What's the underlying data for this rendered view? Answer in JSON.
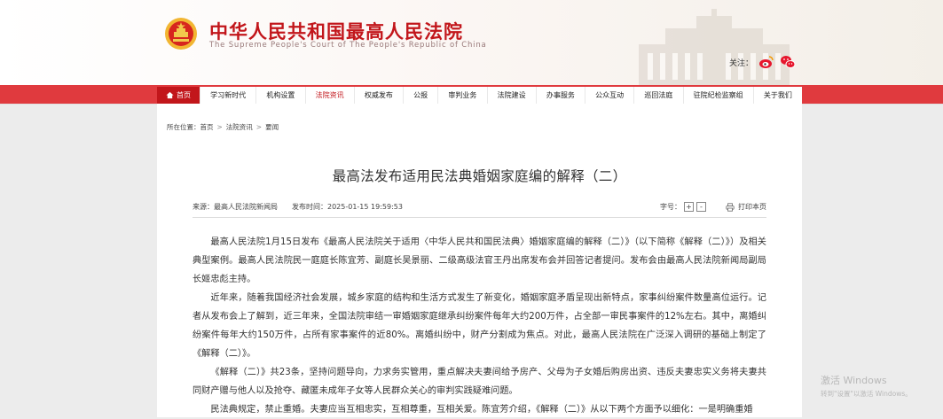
{
  "header": {
    "title": "中华人民共和国最高人民法院",
    "subtitle": "The Supreme People's Court of The People's Republic of China",
    "follow_label": "关注：",
    "social": [
      {
        "name": "weibo-icon",
        "color": "#e6162d"
      },
      {
        "name": "wechat-icon",
        "color": "#e6162d"
      }
    ]
  },
  "nav": {
    "items": [
      {
        "label": "首页",
        "icon": "home-icon",
        "state": "home"
      },
      {
        "label": "学习新时代"
      },
      {
        "label": "机构设置"
      },
      {
        "label": "法院资讯",
        "state": "active"
      },
      {
        "label": "权威发布"
      },
      {
        "label": "公报"
      },
      {
        "label": "审判业务"
      },
      {
        "label": "法院建设"
      },
      {
        "label": "办事服务"
      },
      {
        "label": "公众互动"
      },
      {
        "label": "巡回法庭"
      },
      {
        "label": "驻院纪检监察组"
      },
      {
        "label": "关于我们"
      }
    ]
  },
  "breadcrumb": {
    "prefix": "所在位置：",
    "items": [
      "首页",
      "法院资讯",
      "要闻"
    ],
    "separator": ">"
  },
  "article": {
    "title": "最高法发布适用民法典婚姻家庭编的解释（二）",
    "source": "来源：最高人民法院新闻局",
    "publish_time": "发布时间：2025-01-15 19:59:53",
    "font_size_label": "字号：",
    "font_increase": "+",
    "font_decrease": "-",
    "print_label": "打印本页",
    "paragraphs": [
      "最高人民法院1月15日发布《最高人民法院关于适用〈中华人民共和国民法典〉婚姻家庭编的解释（二）》（以下简称《解释（二）》）及相关典型案例。最高人民法院民一庭庭长陈宜芳、副庭长吴景丽、二级高级法官王丹出席发布会并回答记者提问。发布会由最高人民法院新闻局副局长姬忠彪主持。",
      "近年来，随着我国经济社会发展，城乡家庭的结构和生活方式发生了新变化，婚姻家庭矛盾呈现出新特点，家事纠纷案件数量高位运行。记者从发布会上了解到，近三年来，全国法院审结一审婚姻家庭继承纠纷案件每年大约200万件，占全部一审民事案件的12%左右。其中，离婚纠纷案件每年大约150万件，占所有家事案件的近80%。离婚纠纷中，财产分割成为焦点。对此，最高人民法院在广泛深入调研的基础上制定了《解释（二）》。",
      "《解释（二）》共23条，坚持问题导向，力求务实管用，重点解决夫妻间给予房产、父母为子女婚后购房出资、违反夫妻忠实义务将夫妻共同财产赠与他人以及抢夺、藏匿未成年子女等人民群众关心的审判实践疑难问题。",
      "民法典规定，禁止重婚。夫妻应当互相忠实，互相尊重，互相关爱。陈宜芳介绍，《解释（二）》从以下两个方面予以细化：一是明确重婚"
    ]
  },
  "os_watermark": {
    "line1": "激活 Windows",
    "line2": "转到\"设置\"以激活 Windows。"
  },
  "colors": {
    "brand_red": "#c2161b",
    "nav_red": "#e03a3e"
  }
}
